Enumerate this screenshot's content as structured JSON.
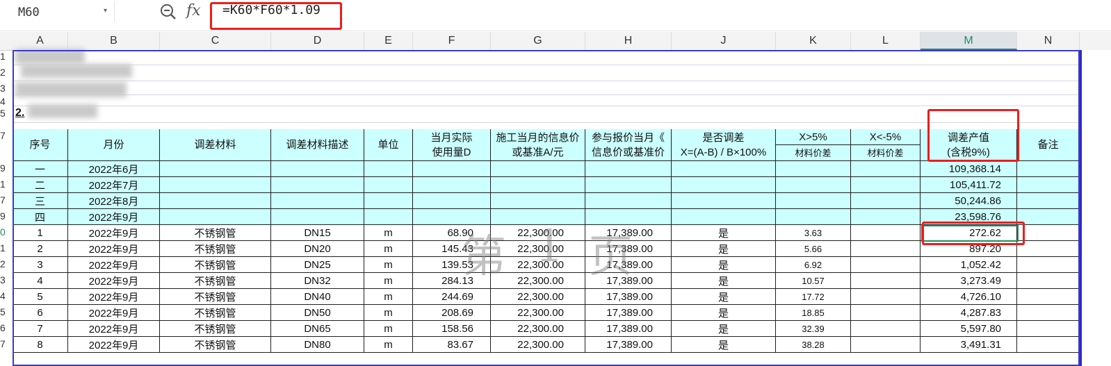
{
  "toolbar": {
    "cell_ref": "M60",
    "dropdown_glyph": "▾",
    "zoom_icon": "zoom-out-icon",
    "fx_label": "fx",
    "formula": "=K60*F60*1.09"
  },
  "columns": [
    "A",
    "B",
    "C",
    "D",
    "E",
    "F",
    "G",
    "H",
    "J",
    "K",
    "L",
    "M",
    "N"
  ],
  "selected_column": "M",
  "row_numbers": [
    "1",
    "2",
    "3",
    "4",
    "5",
    "7",
    "9",
    "1",
    "7",
    "9",
    "0",
    "1",
    "2",
    "3",
    "4",
    "5",
    "6",
    "7"
  ],
  "title_fragment": "2.",
  "headers": {
    "seq": "序号",
    "month": "月份",
    "material": "调差材料",
    "desc": "调差材料描述",
    "unit": "单位",
    "usage_l1": "当月实际",
    "usage_l2": "使用量D",
    "info_l1": "施工当月的信息价",
    "info_l2": "或基准A/元",
    "bid_l1": "参与报价当月《",
    "bid_l2": "信息价或基准价",
    "adjust_l1": "是否调差",
    "adjust_l2": "X=(A-B) / B×100%",
    "over_l1": "X>5%",
    "over_l2": "材料价差",
    "under_l1": "X<-5%",
    "under_l2": "材料价差",
    "value_l1": "调差产值",
    "value_l2": "(含税9%)",
    "remark": "备注"
  },
  "summary_rows": [
    {
      "seq": "一",
      "month": "2022年6月",
      "value": "109,368.14"
    },
    {
      "seq": "二",
      "month": "2022年7月",
      "value": "105,411.72"
    },
    {
      "seq": "三",
      "month": "2022年8月",
      "value": "50,244.86"
    },
    {
      "seq": "四",
      "month": "2022年9月",
      "value": "23,598.76"
    }
  ],
  "detail_rows": [
    {
      "seq": "1",
      "month": "2022年9月",
      "material": "不锈钢管",
      "desc": "DN15",
      "unit": "m",
      "usage": "68.90",
      "info": "22,300.00",
      "bid": "17,389.00",
      "adjust": "是",
      "over": "3.63",
      "value": "272.62"
    },
    {
      "seq": "2",
      "month": "2022年9月",
      "material": "不锈钢管",
      "desc": "DN20",
      "unit": "m",
      "usage": "145.43",
      "info": "22,300.00",
      "bid": "17,389.00",
      "adjust": "是",
      "over": "5.66",
      "value": "897.20"
    },
    {
      "seq": "3",
      "month": "2022年9月",
      "material": "不锈钢管",
      "desc": "DN25",
      "unit": "m",
      "usage": "139.53",
      "info": "22,300.00",
      "bid": "17,389.00",
      "adjust": "是",
      "over": "6.92",
      "value": "1,052.42"
    },
    {
      "seq": "4",
      "month": "2022年9月",
      "material": "不锈钢管",
      "desc": "DN32",
      "unit": "m",
      "usage": "284.13",
      "info": "22,300.00",
      "bid": "17,389.00",
      "adjust": "是",
      "over": "10.57",
      "value": "3,273.49"
    },
    {
      "seq": "5",
      "month": "2022年9月",
      "material": "不锈钢管",
      "desc": "DN40",
      "unit": "m",
      "usage": "244.69",
      "info": "22,300.00",
      "bid": "17,389.00",
      "adjust": "是",
      "over": "17.72",
      "value": "4,726.10"
    },
    {
      "seq": "6",
      "month": "2022年9月",
      "material": "不锈钢管",
      "desc": "DN50",
      "unit": "m",
      "usage": "208.69",
      "info": "22,300.00",
      "bid": "17,389.00",
      "adjust": "是",
      "over": "18.85",
      "value": "4,287.83"
    },
    {
      "seq": "7",
      "month": "2022年9月",
      "material": "不锈钢管",
      "desc": "DN65",
      "unit": "m",
      "usage": "158.56",
      "info": "22,300.00",
      "bid": "17,389.00",
      "adjust": "是",
      "over": "32.39",
      "value": "5,597.80"
    },
    {
      "seq": "8",
      "month": "2022年9月",
      "material": "不锈钢管",
      "desc": "DN80",
      "unit": "m",
      "usage": "83.67",
      "info": "22,300.00",
      "bid": "17,389.00",
      "adjust": "是",
      "over": "38.28",
      "value": "3,491.31"
    }
  ],
  "watermark": [
    "第",
    "1",
    "页"
  ],
  "colors": {
    "header_fill": "#ccffff",
    "highlight": "#ee1c1c",
    "active": "#1f8f5a"
  }
}
